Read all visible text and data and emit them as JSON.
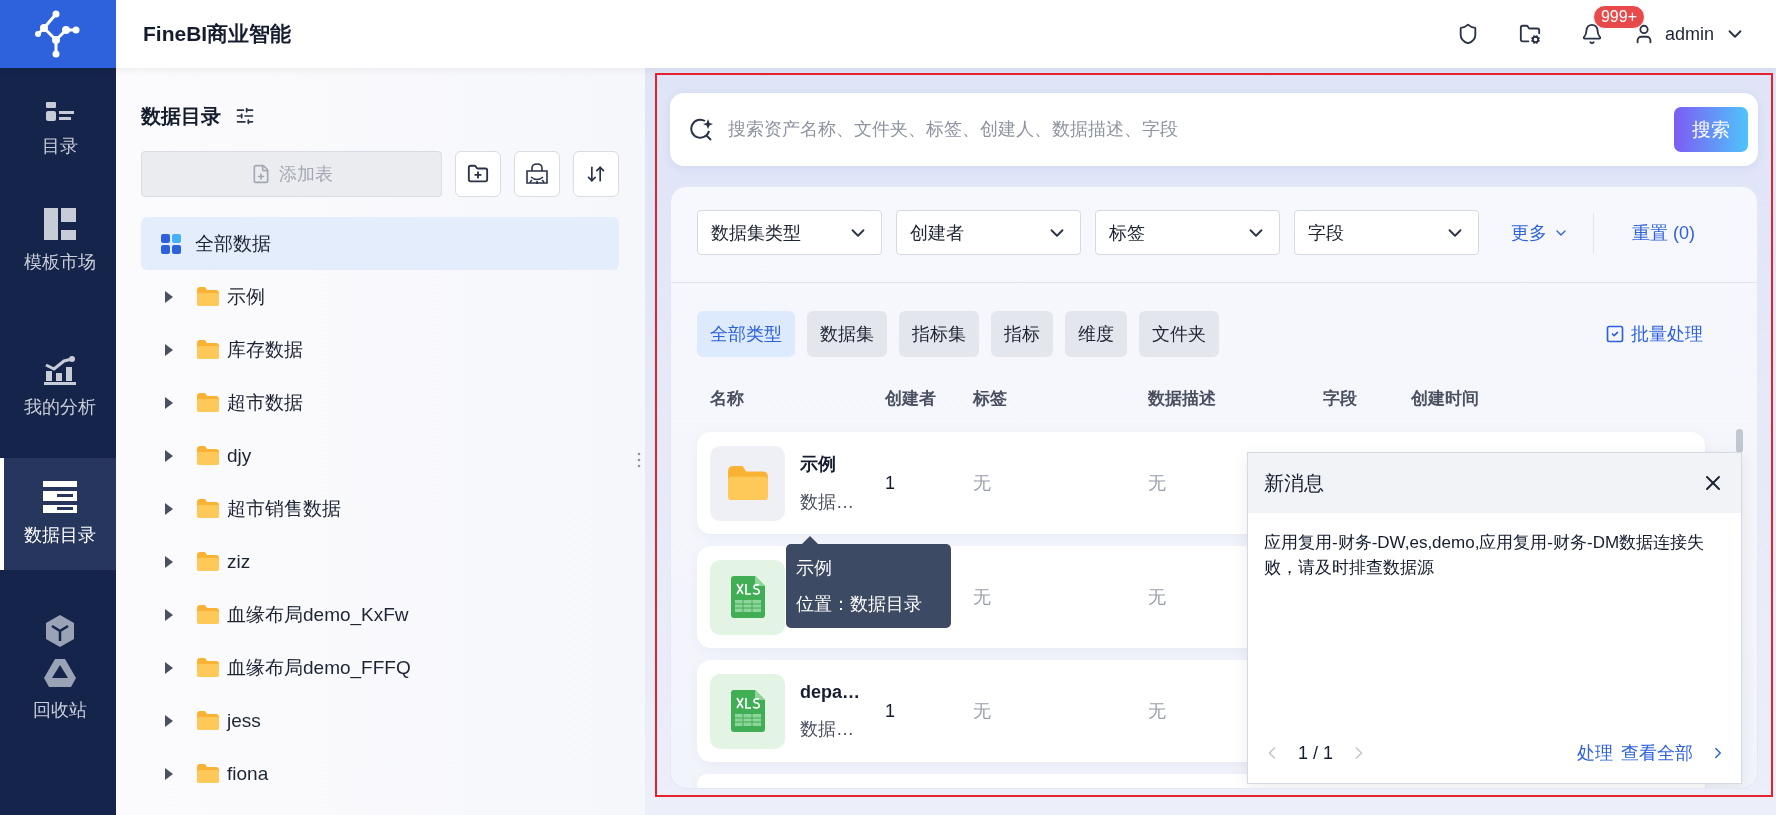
{
  "header": {
    "title": "FineBI商业智能",
    "notification_badge": "999+",
    "user": "admin"
  },
  "nav": [
    {
      "label": "目录",
      "kind": "catalog",
      "selected": false
    },
    {
      "label": "模板市场",
      "kind": "market",
      "selected": false
    },
    {
      "label": "我的分析",
      "kind": "analysis",
      "selected": false
    },
    {
      "label": "数据目录",
      "kind": "data",
      "selected": true
    },
    {
      "label": "回收站",
      "kind": "recycle",
      "selected": false
    }
  ],
  "tree": {
    "title": "数据目录",
    "add_button": "添加表",
    "add_disabled": true,
    "root": {
      "label": "全部数据",
      "selected": true
    },
    "folders": [
      {
        "label": "示例",
        "expanded": false
      },
      {
        "label": "库存数据",
        "expanded": false
      },
      {
        "label": "超市数据",
        "expanded": false
      },
      {
        "label": "djy",
        "expanded": false
      },
      {
        "label": "超市销售数据",
        "expanded": false
      },
      {
        "label": "ziz",
        "expanded": false
      },
      {
        "label": "血缘布局demo_KxFw",
        "expanded": false
      },
      {
        "label": "血缘布局demo_FFFQ",
        "expanded": false
      },
      {
        "label": "jess",
        "expanded": false
      },
      {
        "label": "fiona",
        "expanded": false
      }
    ]
  },
  "search": {
    "placeholder": "搜索资产名称、文件夹、标签、创建人、数据描述、字段",
    "button": "搜索"
  },
  "filters": [
    {
      "label": "数据集类型"
    },
    {
      "label": "创建者"
    },
    {
      "label": "标签"
    },
    {
      "label": "字段"
    }
  ],
  "more": "更多",
  "reset": "重置 (0)",
  "type_tabs": [
    {
      "label": "全部类型",
      "selected": true
    },
    {
      "label": "数据集",
      "selected": false
    },
    {
      "label": "指标集",
      "selected": false
    },
    {
      "label": "指标",
      "selected": false
    },
    {
      "label": "维度",
      "selected": false
    },
    {
      "label": "文件夹",
      "selected": false
    }
  ],
  "batch": "批量处理",
  "columns": [
    "名称",
    "创建者",
    "标签",
    "数据描述",
    "字段",
    "创建时间"
  ],
  "rows": [
    {
      "kind": "folder",
      "name": "示例",
      "subtitle": "数据…",
      "creator": "1",
      "tags": "无",
      "description": "无"
    },
    {
      "kind": "excel",
      "tags": "无",
      "description": "无"
    },
    {
      "kind": "excel",
      "name": "depa…",
      "subtitle": "数据…",
      "creator": "1",
      "tags": "无",
      "description": "无"
    },
    {
      "kind": "blank"
    }
  ],
  "tooltip": {
    "title": "示例",
    "location": "位置：数据目录"
  },
  "message": {
    "title": "新消息",
    "body": "应用复用-财务-DW,es,demo,应用复用-财务-DM数据连接失败，请及时排查数据源",
    "pager": "1 / 1",
    "actions": [
      "处理",
      "查看全部"
    ]
  }
}
